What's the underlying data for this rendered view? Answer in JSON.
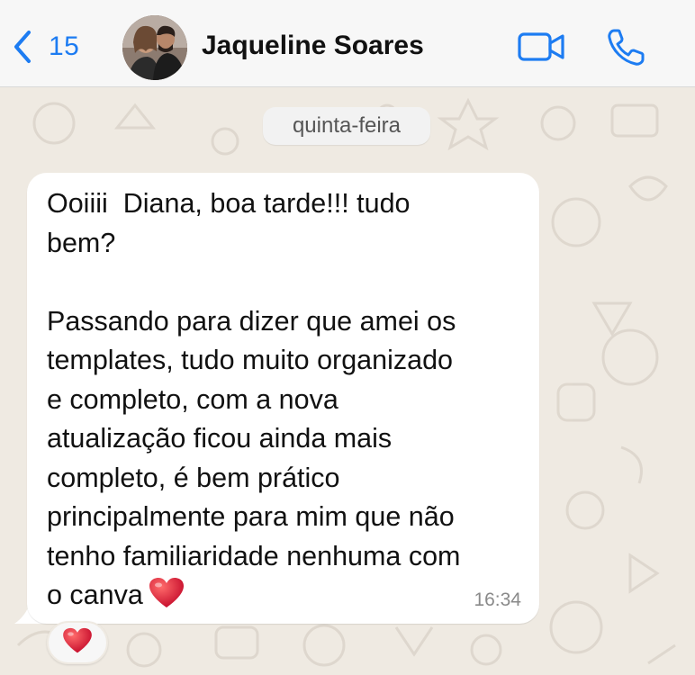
{
  "header": {
    "back_count": "15",
    "contact_name": "Jaqueline Soares",
    "back_icon": "chevron-left-icon",
    "video_icon": "video-camera-icon",
    "phone_icon": "phone-icon",
    "accent_color": "#1d7cf2"
  },
  "chat": {
    "day_separator": "quinta-feira",
    "message": {
      "lines": [
        "Ooiiii  Diana, boa tarde!!! tudo",
        "bem?",
        "",
        "Passando para dizer que amei os",
        "templates, tudo muito organizado",
        "e completo, com a nova",
        "atualização ficou ainda mais",
        "completo, é bem prático",
        "principalmente para mim que não",
        "tenho familiaridade nenhuma com",
        "o canva"
      ],
      "emoji": "heart-icon",
      "time": "16:34",
      "reaction": "heart-icon"
    }
  }
}
